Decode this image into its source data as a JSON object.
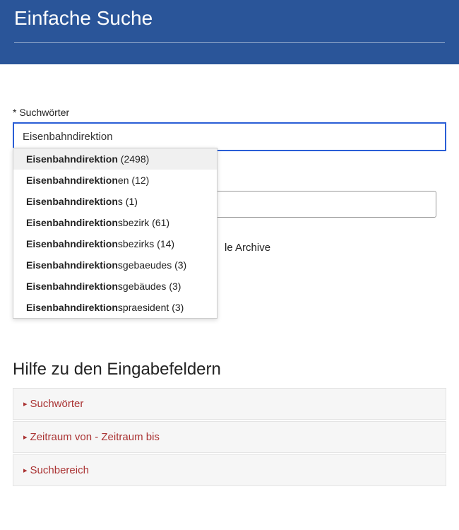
{
  "header": {
    "title": "Einfache Suche"
  },
  "search": {
    "label": "* Suchwörter",
    "value": "Eisenbahndirektion",
    "suggestions": [
      {
        "prefix": "Eisenbahndirektion",
        "suffix": "",
        "count": "(2498)",
        "highlighted": true
      },
      {
        "prefix": "Eisenbahndirektion",
        "suffix": "en",
        "count": "(12)",
        "highlighted": false
      },
      {
        "prefix": "Eisenbahndirektion",
        "suffix": "s",
        "count": "(1)",
        "highlighted": false
      },
      {
        "prefix": "Eisenbahndirektion",
        "suffix": "sbezirk",
        "count": "(61)",
        "highlighted": false
      },
      {
        "prefix": "Eisenbahndirektion",
        "suffix": "sbezirks",
        "count": "(14)",
        "highlighted": false
      },
      {
        "prefix": "Eisenbahndirektion",
        "suffix": "sgebaeudes",
        "count": "(3)",
        "highlighted": false
      },
      {
        "prefix": "Eisenbahndirektion",
        "suffix": "sgebäudes",
        "count": "(3)",
        "highlighted": false
      },
      {
        "prefix": "Eisenbahndirektion",
        "suffix": "spraesident",
        "count": "(3)",
        "highlighted": false
      }
    ]
  },
  "archive_text": "le Archive",
  "help": {
    "title": "Hilfe zu den Eingabefeldern",
    "items": [
      {
        "label": "Suchwörter"
      },
      {
        "label": "Zeitraum von - Zeitraum bis"
      },
      {
        "label": "Suchbereich"
      }
    ]
  }
}
